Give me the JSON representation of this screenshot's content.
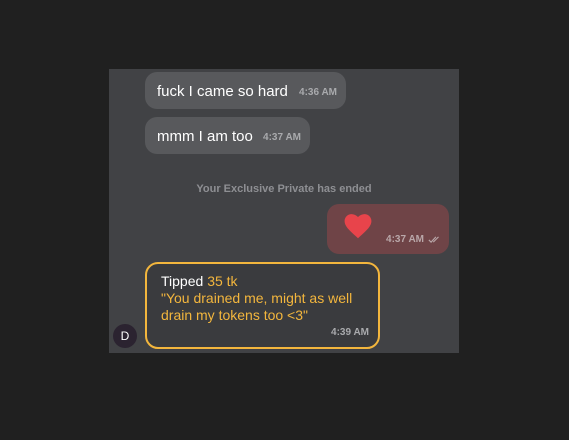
{
  "messages": [
    {
      "text": "fuck I came so hard",
      "time": "4:36 AM"
    },
    {
      "text": "mmm I am too",
      "time": "4:37 AM"
    }
  ],
  "system_note": "Your Exclusive Private has ended",
  "outgoing": {
    "icon": "heart-icon",
    "time": "4:37 AM",
    "status_icon": "double-check-icon"
  },
  "tip": {
    "label": "Tipped",
    "amount": "35 tk",
    "message": "\"You drained me, might as well drain my tokens too <3\"",
    "time": "4:39 AM"
  },
  "avatar": {
    "initial": "D"
  },
  "colors": {
    "page_bg": "#202020",
    "panel_bg": "#414245",
    "incoming_bubble": "#58595c",
    "outgoing_bubble": "#6f4447",
    "heart": "#e8444b",
    "accent": "#f3b63d"
  }
}
